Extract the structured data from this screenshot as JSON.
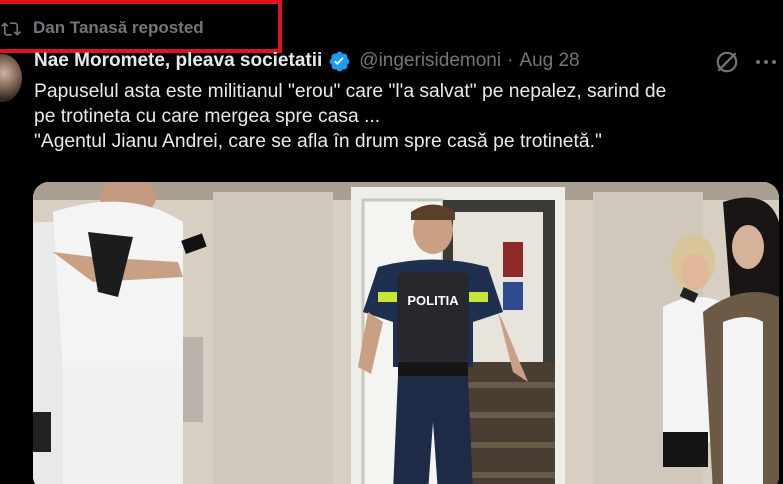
{
  "repost": {
    "label": "Dan Tanasă reposted",
    "highlight_color": "#e0151c"
  },
  "tweet": {
    "author_name": "Nae Moromete, pleava societatii",
    "verified": true,
    "verified_color": "#1d9bf0",
    "handle": "@ingerisidemoni",
    "separator": "·",
    "date": "Aug 28",
    "text_lines": [
      "Papuselul asta este militianul \"erou\" care \"l'a salvat\" pe nepalez, sarind de",
      "pe trotineta cu care mergea spre casa ...",
      "\"Agentul Jianu Andrei, care se afla în drum spre casă pe trotinetă.\""
    ]
  },
  "media": {
    "vest_text": "POLITIA"
  },
  "icons": {
    "repost": "repost-icon",
    "verified": "verified-badge-icon",
    "grok": "grok-icon",
    "more": "more-icon"
  },
  "colors": {
    "background": "#000000",
    "text": "#e7e9ea",
    "secondary": "#71767b"
  }
}
